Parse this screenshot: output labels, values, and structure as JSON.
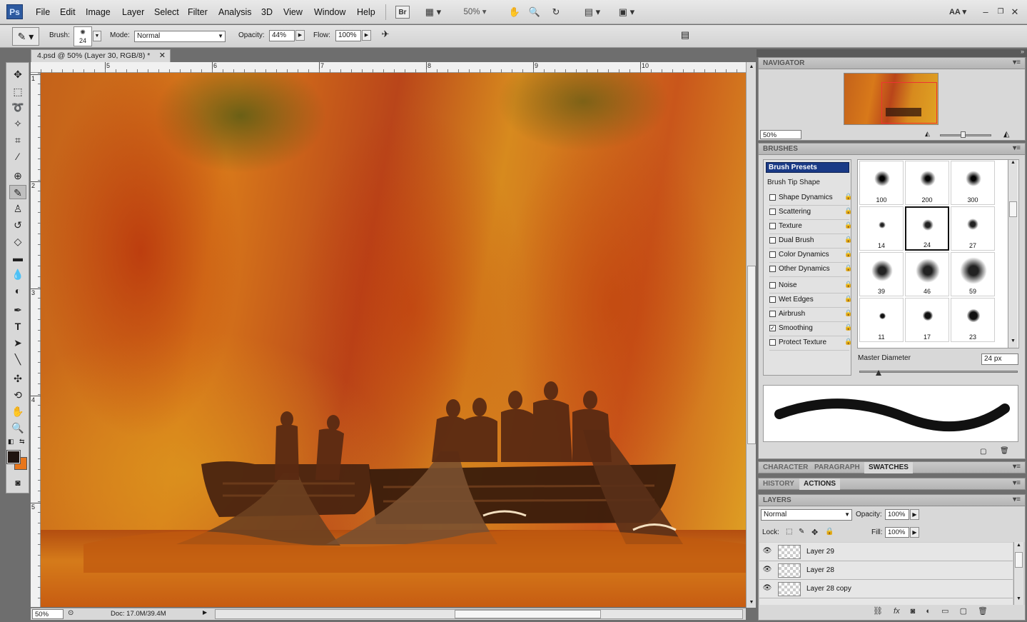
{
  "app": {
    "logo": "Ps",
    "workspace": "AA"
  },
  "menu": [
    "File",
    "Edit",
    "Image",
    "Layer",
    "Select",
    "Filter",
    "Analysis",
    "3D",
    "View",
    "Window",
    "Help"
  ],
  "apptoolbar": {
    "bridge": "Br",
    "zoom": "50%"
  },
  "options": {
    "brush_label": "Brush:",
    "brush_size": "24",
    "mode_label": "Mode:",
    "mode_value": "Normal",
    "opacity_label": "Opacity:",
    "opacity_value": "44%",
    "flow_label": "Flow:",
    "flow_value": "100%"
  },
  "document": {
    "tab_title": "4.psd @ 50% (Layer 30, RGB/8) *",
    "ruler_top": [
      "5",
      "6",
      "7",
      "8",
      "9",
      "10"
    ],
    "ruler_left": [
      "1",
      "2",
      "3",
      "4",
      "5"
    ],
    "zoom": "50%",
    "doc_info": "Doc: 17.0M/39.4M"
  },
  "navigator": {
    "title": "NAVIGATOR",
    "zoom": "50%"
  },
  "brushes": {
    "title": "BRUSHES",
    "presets_label": "Brush Presets",
    "tip_shape_label": "Brush Tip Shape",
    "options": [
      {
        "label": "Shape Dynamics",
        "checked": false
      },
      {
        "label": "Scattering",
        "checked": false
      },
      {
        "label": "Texture",
        "checked": false
      },
      {
        "label": "Dual Brush",
        "checked": false
      },
      {
        "label": "Color Dynamics",
        "checked": false
      },
      {
        "label": "Other Dynamics",
        "checked": false
      },
      {
        "label": "Noise",
        "checked": false
      },
      {
        "label": "Wet Edges",
        "checked": false
      },
      {
        "label": "Airbrush",
        "checked": false
      },
      {
        "label": "Smoothing",
        "checked": true
      },
      {
        "label": "Protect Texture",
        "checked": false
      }
    ],
    "presets": [
      "100",
      "200",
      "300",
      "14",
      "24",
      "27",
      "39",
      "46",
      "59",
      "11",
      "17",
      "23"
    ],
    "selected_preset": "24",
    "master_diameter_label": "Master Diameter",
    "master_diameter_value": "24 px"
  },
  "tabs_group1": [
    "CHARACTER",
    "PARAGRAPH",
    "SWATCHES"
  ],
  "tabs_group2": [
    "HISTORY",
    "ACTIONS"
  ],
  "layers": {
    "title": "LAYERS",
    "blend_mode": "Normal",
    "opacity_label": "Opacity:",
    "opacity_value": "100%",
    "lock_label": "Lock:",
    "fill_label": "Fill:",
    "fill_value": "100%",
    "items": [
      "Layer 29",
      "Layer 28",
      "Layer 28 copy"
    ]
  },
  "colors": {
    "foreground": "#1e1410",
    "background": "#e8761c",
    "accent": "#1a3a86"
  }
}
